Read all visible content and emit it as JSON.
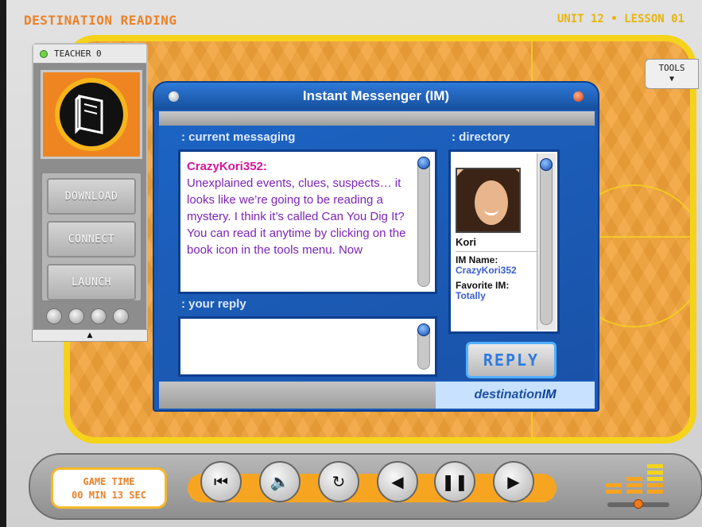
{
  "header": {
    "title": "DESTINATION READING",
    "unit_lesson": "UNIT 12 • LESSON 01"
  },
  "teacher_panel": {
    "label": "TEACHER 0",
    "buttons": [
      "DOWNLOAD",
      "CONNECT",
      "LAUNCH"
    ]
  },
  "tools": {
    "label": "TOOLS"
  },
  "im": {
    "title": "Instant Messenger (IM)",
    "current_label": ": current messaging",
    "directory_label": ": directory",
    "reply_label": ": your reply",
    "sender": "CrazyKori352:",
    "message": "Unexplained events, clues, suspects… it looks like we’re going to be reading a mystery. I think it’s called Can You Dig It? You can read it anytime by clicking on the book icon in the tools menu. Now",
    "reply_value": "",
    "reply_button": "REPLY",
    "brand_prefix": "destination",
    "brand_suffix": "IM",
    "directory": {
      "name": "Kori",
      "im_name_label": "IM Name:",
      "im_name": "CrazyKori352",
      "favorite_label": "Favorite IM:",
      "favorite": "Totally"
    }
  },
  "bottom": {
    "game_time_label": "GAME TIME",
    "game_time_value": "00 MIN 13 SEC",
    "controls": [
      "skip-back-icon",
      "volume-icon",
      "replay-icon",
      "back-icon",
      "pause-icon",
      "play-icon"
    ],
    "volume_level": 0.5
  }
}
